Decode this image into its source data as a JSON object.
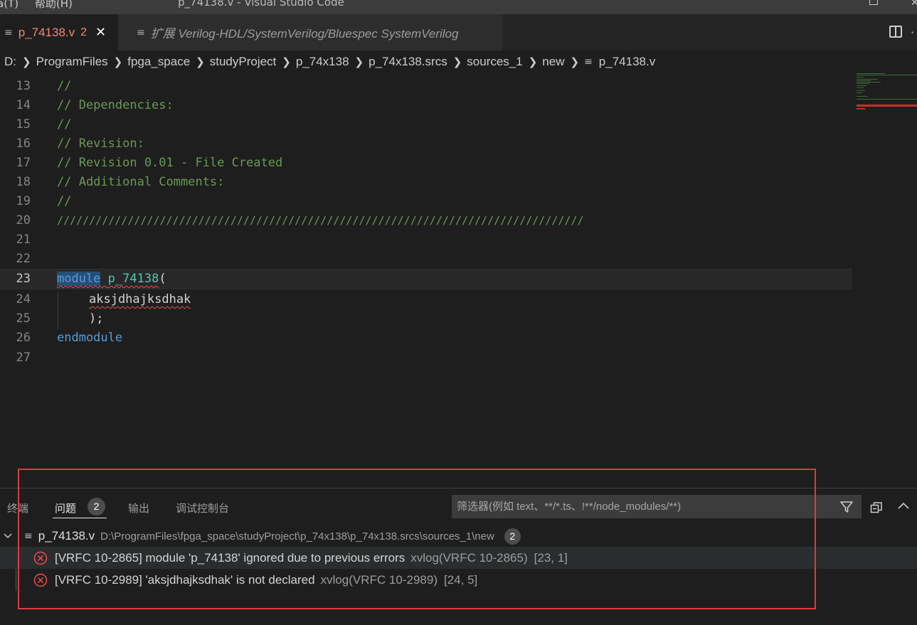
{
  "window": {
    "menu": [
      "a(T)",
      "帮助(H)"
    ],
    "title": "p_74138.v - Visual Studio Code"
  },
  "tabs": [
    {
      "label": "p_74138.v",
      "problems": "2",
      "icon": "file-lines-icon",
      "active": true
    },
    {
      "label": "扩展 Verilog-HDL/SystemVerilog/Bluespec SystemVerilog",
      "icon": "file-lines-icon",
      "active": false
    }
  ],
  "breadcrumb": [
    "D:",
    "ProgramFiles",
    "fpga_space",
    "studyProject",
    "p_74x138",
    "p_74x138.srcs",
    "sources_1",
    "new",
    "p_74138.v"
  ],
  "editor": {
    "lines": [
      {
        "n": "13",
        "text": "//"
      },
      {
        "n": "14",
        "text": "// Dependencies:"
      },
      {
        "n": "15",
        "text": "//"
      },
      {
        "n": "16",
        "text": "// Revision:"
      },
      {
        "n": "17",
        "text": "// Revision 0.01 - File Created"
      },
      {
        "n": "18",
        "text": "// Additional Comments:"
      },
      {
        "n": "19",
        "text": "//"
      },
      {
        "n": "20",
        "text": "//////////////////////////////////////////////////////////////////////////////////"
      },
      {
        "n": "21",
        "text": ""
      },
      {
        "n": "22",
        "text": ""
      },
      {
        "n": "23",
        "kw": "module",
        "ident": "p_74138",
        "punct": "("
      },
      {
        "n": "24",
        "text": "aksjdhajksdhak"
      },
      {
        "n": "25",
        "text": ");"
      },
      {
        "n": "26",
        "text": "endmodule"
      },
      {
        "n": "27",
        "text": ""
      }
    ]
  },
  "panel": {
    "tabs": [
      "终端",
      "问题",
      "输出",
      "调试控制台"
    ],
    "problem_count": "2",
    "filter_placeholder": "筛选器(例如 text、**/*.ts、!**/node_modules/**)",
    "file": {
      "name": "p_74138.v",
      "path": "D:\\ProgramFiles\\fpga_space\\studyProject\\p_74x138\\p_74x138.srcs\\sources_1\\new",
      "count": "2"
    },
    "problems": [
      {
        "message": "[VRFC 10-2865] module 'p_74138' ignored due to previous errors",
        "source": "xvlog(VRFC 10-2865)",
        "position": "[23, 1]"
      },
      {
        "message": "[VRFC 10-2989] 'aksjdhajksdhak' is not declared",
        "source": "xvlog(VRFC 10-2989)",
        "position": "[24, 5]"
      }
    ]
  },
  "colors": {
    "error": "#f14c4c",
    "comment": "#6a9955",
    "keyword": "#569cd6",
    "type": "#4ec9b0",
    "annotation": "#e03a3a"
  }
}
